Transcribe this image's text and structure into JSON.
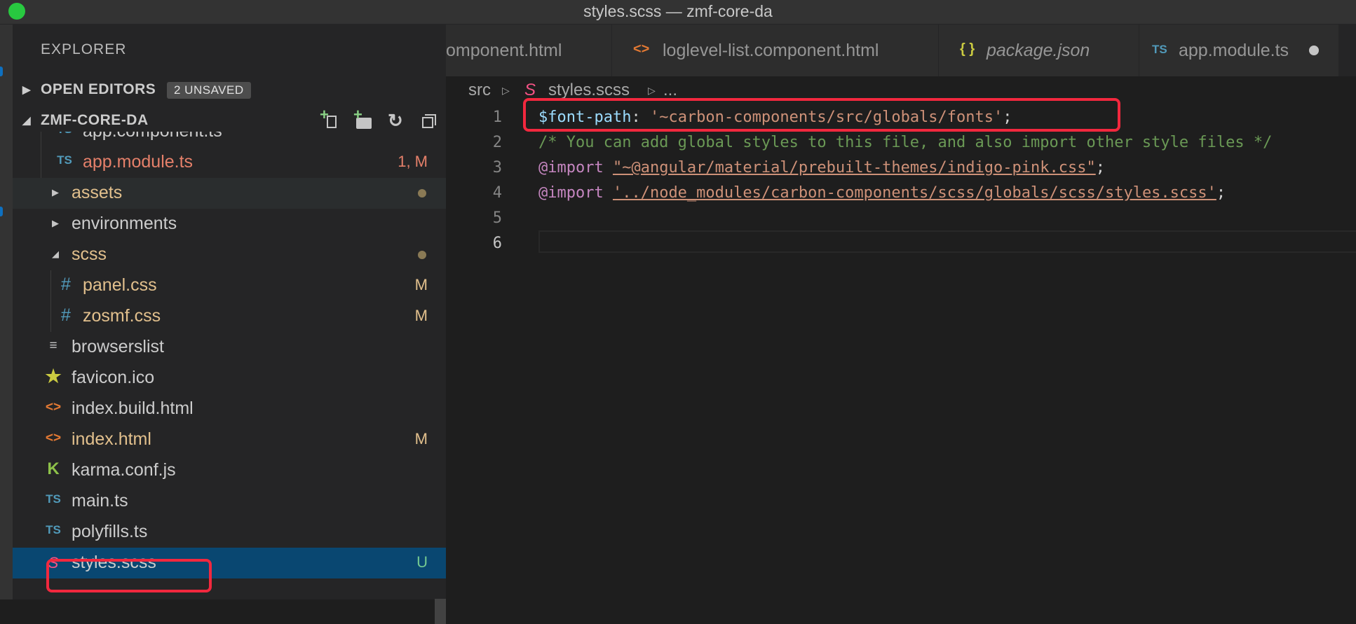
{
  "window": {
    "title": "styles.scss — zmf-core-da"
  },
  "sidebar": {
    "title": "EXPLORER",
    "open_editors": {
      "label": "OPEN EDITORS",
      "badge": "2 UNSAVED"
    },
    "project": {
      "label": "ZMF-CORE-DA"
    },
    "files": [
      {
        "name": "app.component.ts",
        "icon": "TS",
        "status": ""
      },
      {
        "name": "app.module.ts",
        "icon": "TS",
        "status": "1, M"
      },
      {
        "name": "assets",
        "icon": "",
        "status": ""
      },
      {
        "name": "environments",
        "icon": "",
        "status": ""
      },
      {
        "name": "scss",
        "icon": "",
        "status": ""
      },
      {
        "name": "panel.css",
        "icon": "#",
        "status": "M"
      },
      {
        "name": "zosmf.css",
        "icon": "#",
        "status": "M"
      },
      {
        "name": "browserslist",
        "icon": "≡",
        "status": ""
      },
      {
        "name": "favicon.ico",
        "icon": "★",
        "status": ""
      },
      {
        "name": "index.build.html",
        "icon": "<>",
        "status": ""
      },
      {
        "name": "index.html",
        "icon": "<>",
        "status": "M"
      },
      {
        "name": "karma.conf.js",
        "icon": "K",
        "status": ""
      },
      {
        "name": "main.ts",
        "icon": "TS",
        "status": ""
      },
      {
        "name": "polyfills.ts",
        "icon": "TS",
        "status": ""
      },
      {
        "name": "styles.scss",
        "icon": "S",
        "status": "U"
      }
    ]
  },
  "tabs": [
    {
      "label": "omponent.html",
      "icon": ""
    },
    {
      "label": "loglevel-list.component.html",
      "icon": "<>"
    },
    {
      "label": "package.json",
      "icon": "{ }"
    },
    {
      "label": "app.module.ts",
      "icon": "TS"
    }
  ],
  "breadcrumb": {
    "folder": "src",
    "file": "styles.scss",
    "more": "..."
  },
  "editor": {
    "line_numbers": [
      "1",
      "2",
      "3",
      "4",
      "5",
      "6"
    ],
    "line1": {
      "var": "$font-path",
      "colon": ": ",
      "str": "'~carbon-components/src/globals/fonts'",
      "semi": ";"
    },
    "line2": {
      "comment": "/* You can add global styles to this file, and also import other style files */"
    },
    "line3": {
      "kw": "@import",
      "str": "\"~@angular/material/prebuilt-themes/indigo-pink.css\"",
      "semi": ";"
    },
    "line4": {
      "kw": "@import",
      "str": "'../node_modules/carbon-components/scss/globals/scss/styles.scss'",
      "semi": ";"
    }
  },
  "colors": {
    "accent_highlight": "#f2283e",
    "selection": "#094771"
  }
}
